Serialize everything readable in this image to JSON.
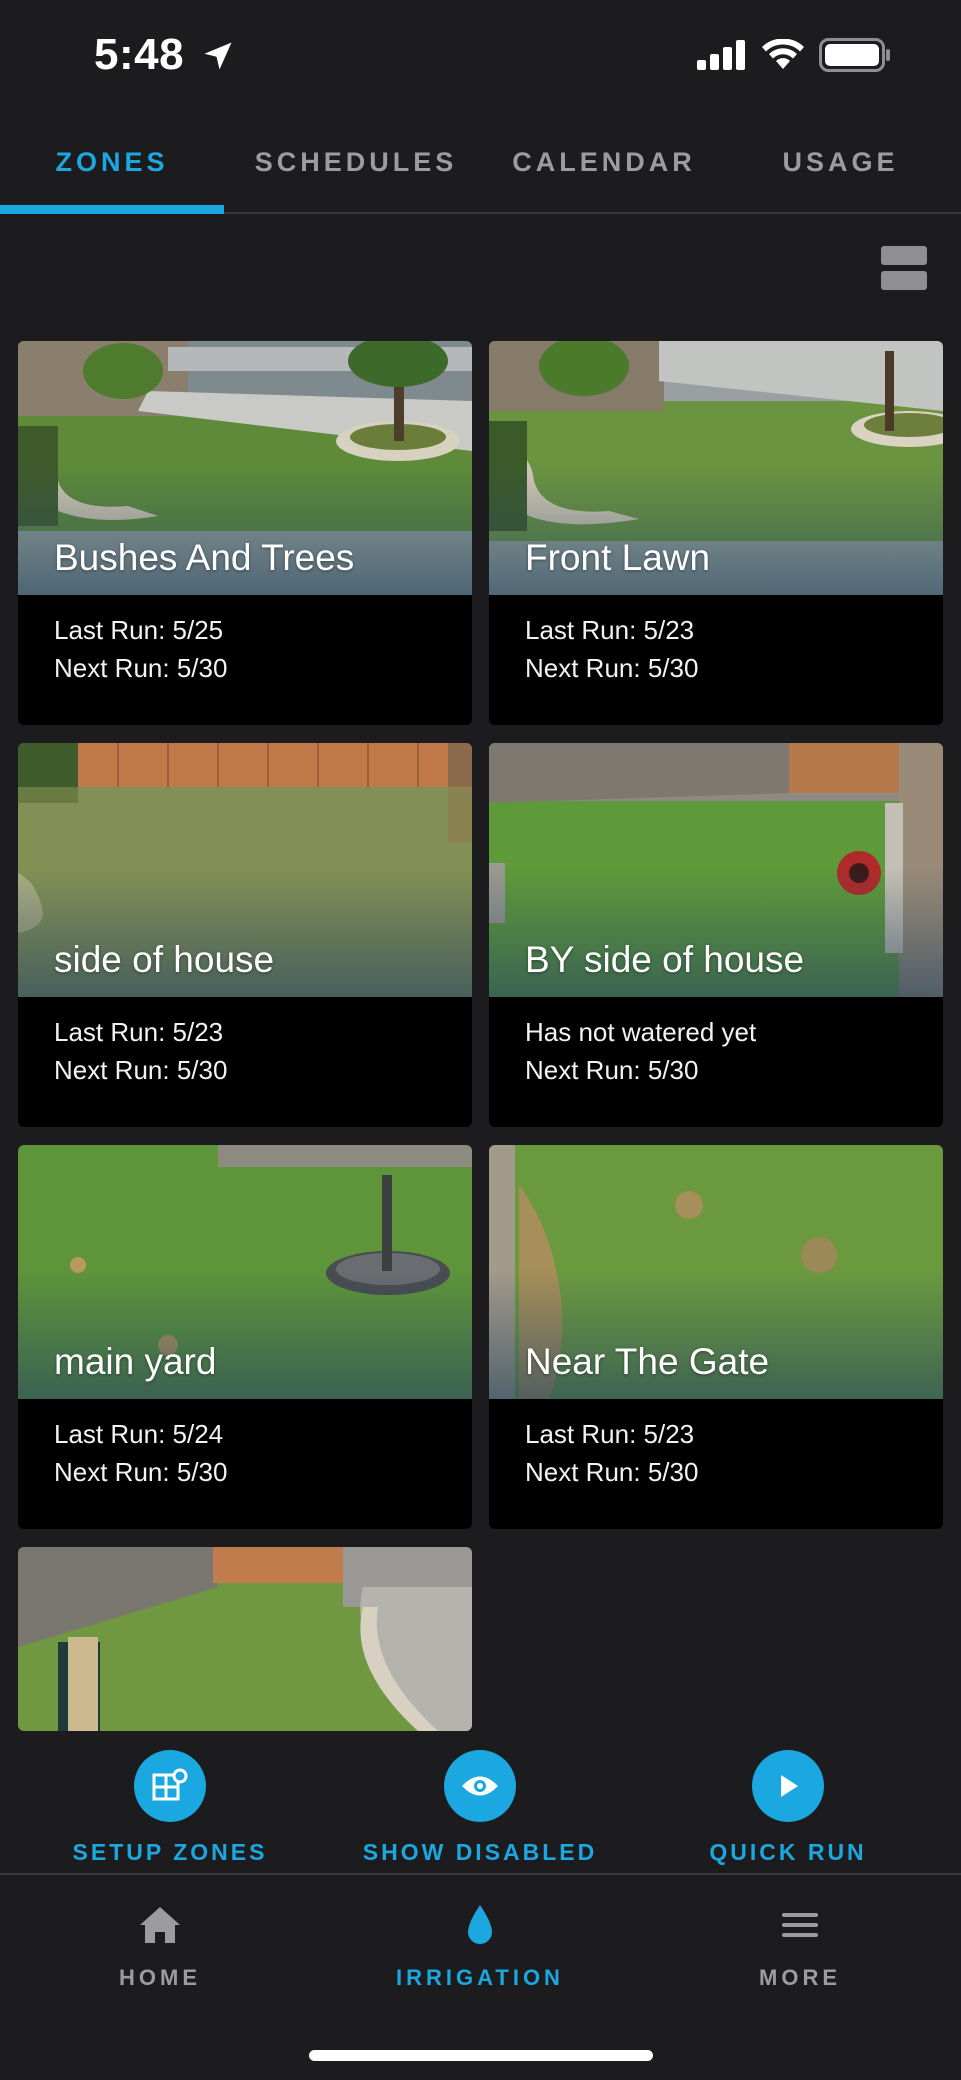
{
  "status_bar": {
    "time": "5:48"
  },
  "top_tabs": [
    {
      "label": "ZONES",
      "active": true
    },
    {
      "label": "SCHEDULES",
      "active": false
    },
    {
      "label": "CALENDAR",
      "active": false
    },
    {
      "label": "USAGE",
      "active": false
    }
  ],
  "zones": [
    {
      "name": "Bushes And Trees",
      "line1": "Last Run: 5/25",
      "line2": "Next Run: 5/30"
    },
    {
      "name": "Front Lawn",
      "line1": "Last Run: 5/23",
      "line2": "Next Run: 5/30"
    },
    {
      "name": "side of house",
      "line1": "Last Run: 5/23",
      "line2": "Next Run: 5/30"
    },
    {
      "name": "BY side of house",
      "line1": "Has not watered yet",
      "line2": "Next Run: 5/30"
    },
    {
      "name": "main yard",
      "line1": "Last Run: 5/24",
      "line2": "Next Run: 5/30"
    },
    {
      "name": "Near The Gate",
      "line1": "Last Run: 5/23",
      "line2": "Next Run: 5/30"
    }
  ],
  "actions": {
    "setup_zones": "SETUP ZONES",
    "show_disabled": "SHOW DISABLED",
    "quick_run": "QUICK RUN"
  },
  "bottom_nav": {
    "home": "HOME",
    "irrigation": "IRRIGATION",
    "more": "MORE"
  },
  "colors": {
    "accent": "#1ba7e0",
    "background": "#1c1c1e",
    "inactive": "#9b9ba0"
  }
}
